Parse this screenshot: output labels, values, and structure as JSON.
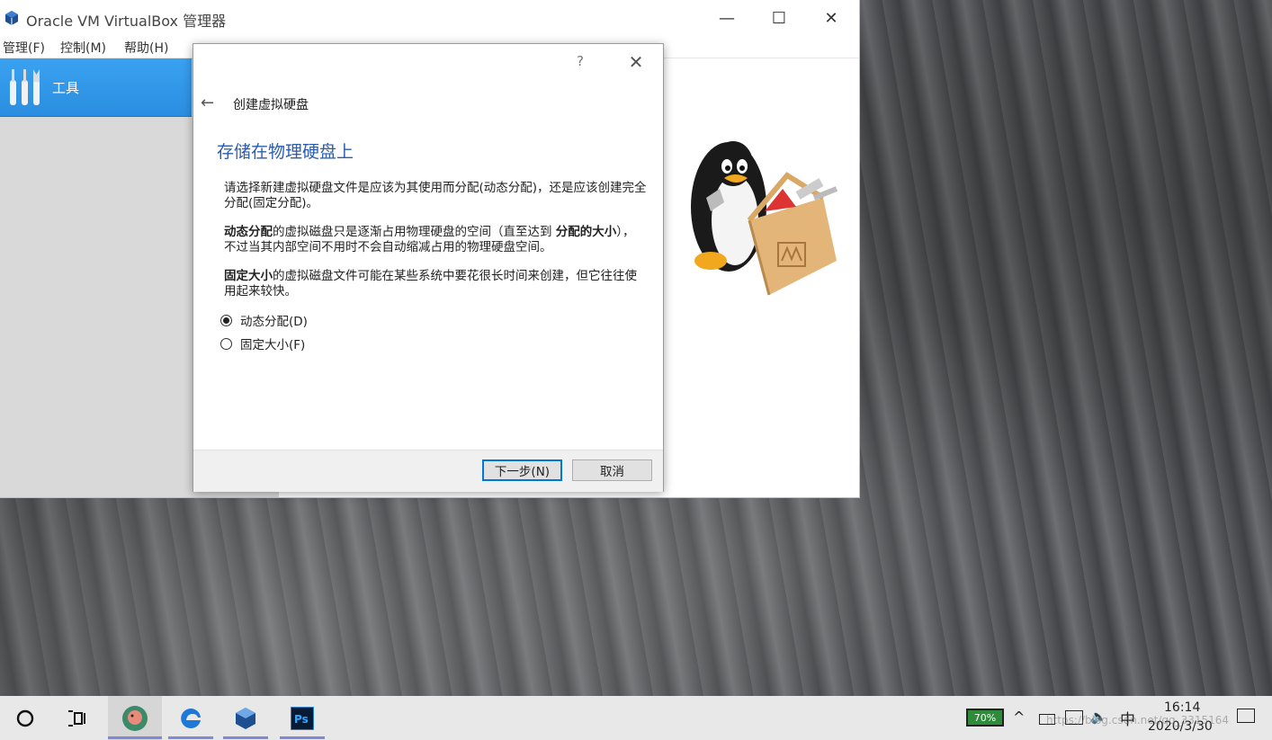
{
  "window": {
    "title": "Oracle VM VirtualBox 管理器",
    "minimize": "—",
    "maximize": "☐",
    "close": "✕"
  },
  "menu": {
    "items": [
      "管理(F)",
      "控制(M)",
      "帮助(H)"
    ]
  },
  "sidebar": {
    "tools_label": "工具"
  },
  "dialog": {
    "help": "?",
    "close": "✕",
    "back": "←",
    "title": "创建虚拟硬盘",
    "heading": "存储在物理硬盘上",
    "para1": "请选择新建虚拟硬盘文件是应该为其使用而分配(动态分配)，还是应该创建完全分配(固定分配)。",
    "para2_bold1": "动态分配",
    "para2_mid": "的虚拟磁盘只是逐渐占用物理硬盘的空间（直至达到 ",
    "para2_bold2": "分配的大小",
    "para2_end": "），不过当其内部空间不用时不会自动缩减占用的物理硬盘空间。",
    "para3_bold": "固定大小",
    "para3_rest": "的虚拟磁盘文件可能在某些系统中要花很长时间来创建，但它往往使用起来较快。",
    "options": [
      {
        "label": "动态分配(D)",
        "checked": true
      },
      {
        "label": "固定大小(F)",
        "checked": false
      }
    ],
    "next_button": "下一步(N)",
    "cancel_button": "取消"
  },
  "taskbar": {
    "battery": "70%",
    "ime": "中",
    "time": "16:14",
    "date": "2020/3/30",
    "watermark": "https://blog.csdn.net/qq_3315164"
  },
  "colors": {
    "accent": "#0078d7",
    "sidebar_selected": "#2b8ee0",
    "heading": "#2a5db0"
  }
}
